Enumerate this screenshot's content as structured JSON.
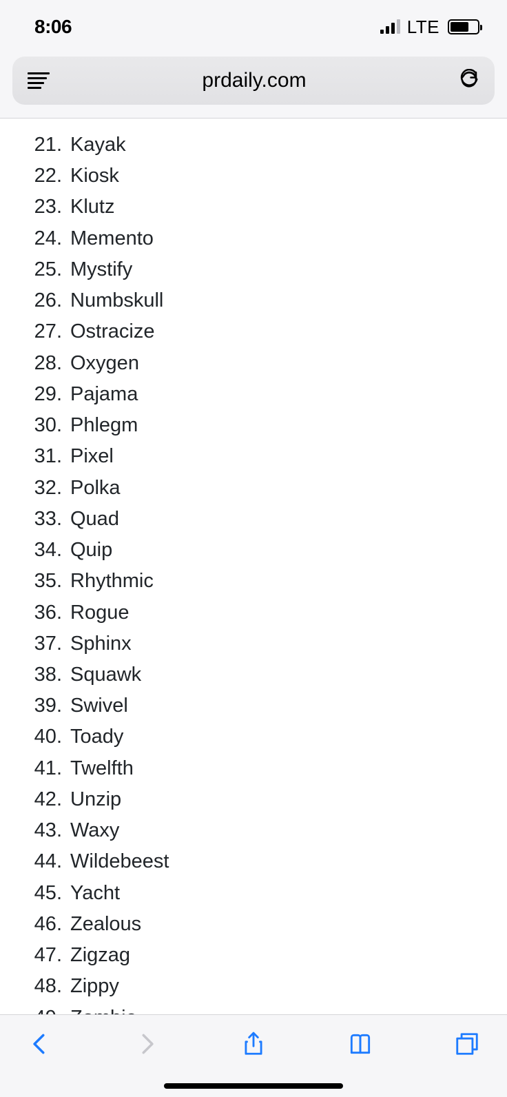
{
  "status_bar": {
    "time": "8:06",
    "network_type": "LTE"
  },
  "url_bar": {
    "domain": "prdaily.com"
  },
  "list": {
    "start_number": 21,
    "items": [
      "Kayak",
      "Kiosk",
      "Klutz",
      "Memento",
      "Mystify",
      "Numbskull",
      "Ostracize",
      "Oxygen",
      "Pajama",
      "Phlegm",
      "Pixel",
      "Polka",
      "Quad",
      "Quip",
      "Rhythmic",
      "Rogue",
      "Sphinx",
      "Squawk",
      "Swivel",
      "Toady",
      "Twelfth",
      "Unzip",
      "Waxy",
      "Wildebeest",
      "Yacht",
      "Zealous",
      "Zigzag",
      "Zippy",
      "Zombie"
    ]
  }
}
